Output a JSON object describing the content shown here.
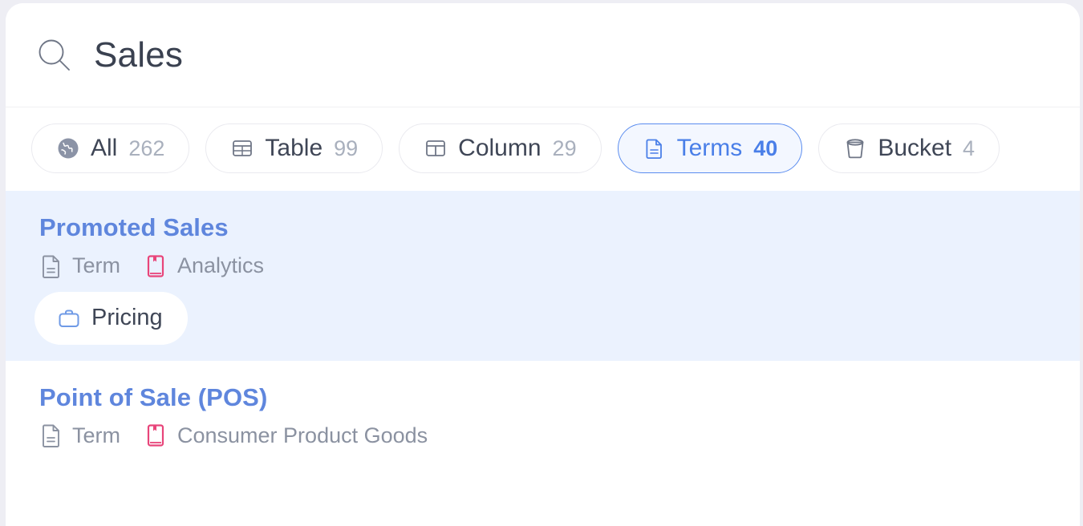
{
  "search": {
    "icon": "search-icon",
    "query": "Sales"
  },
  "filters": [
    {
      "icon": "globe-icon",
      "label": "All",
      "count": "262",
      "active": false
    },
    {
      "icon": "table-icon",
      "label": "Table",
      "count": "99",
      "active": false
    },
    {
      "icon": "column-icon",
      "label": "Column",
      "count": "29",
      "active": false
    },
    {
      "icon": "document-icon",
      "label": "Terms",
      "count": "40",
      "active": true
    },
    {
      "icon": "bucket-icon",
      "label": "Bucket",
      "count": "4",
      "active": false
    }
  ],
  "results": [
    {
      "title": "Promoted Sales",
      "highlighted": true,
      "meta": [
        {
          "icon": "document-icon",
          "label": "Term"
        },
        {
          "icon": "book-icon",
          "label": "Analytics"
        }
      ],
      "tag": {
        "icon": "briefcase-icon",
        "label": "Pricing"
      }
    },
    {
      "title": "Point of Sale (POS)",
      "highlighted": false,
      "meta": [
        {
          "icon": "document-icon",
          "label": "Term"
        },
        {
          "icon": "book-icon",
          "label": "Consumer Product Goods"
        }
      ],
      "tag": null
    }
  ],
  "colors": {
    "accent_blue": "#5b8def",
    "title_blue": "#5f86dd",
    "highlight_bg": "#ebf2fe",
    "book_pink": "#e8457a",
    "meta_gray": "#8b92a1",
    "page_bg": "#eeeef4"
  }
}
